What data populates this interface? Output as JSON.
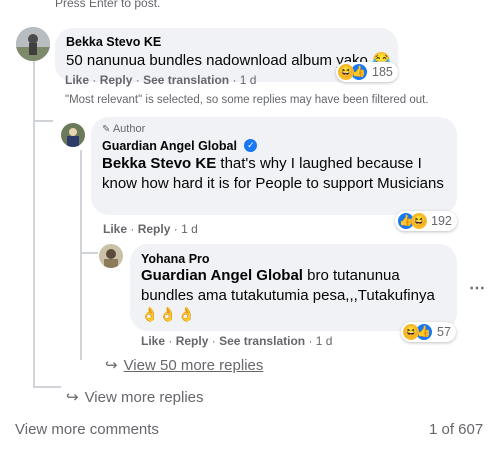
{
  "composer": {
    "hint": "Press Enter to post."
  },
  "comment1": {
    "author": "Bekka Stevo KE",
    "text": "50 nanunua bundles nadownload album yako",
    "emoji": "😂",
    "reaction_count": "185",
    "actions": {
      "like": "Like",
      "reply": "Reply",
      "translate": "See translation",
      "time": "1 d"
    }
  },
  "filter_note": "\"Most relevant\" is selected, so some replies may have been filtered out.",
  "reply1": {
    "badge": "Author",
    "author": "Guardian Angel Global",
    "mention": "Bekka Stevo KE",
    "text": " that's why I laughed because I know how hard it is for People to support Musicians",
    "reaction_count": "192",
    "actions": {
      "like": "Like",
      "reply": "Reply",
      "time": "1 d"
    }
  },
  "reply2": {
    "author": "Yohana Pro",
    "mention": "Guardian Angel Global",
    "text": " bro tutanunua bundles ama tutakutumia pesa,,,Tutakufinya",
    "emojis": "👌👌👌",
    "reaction_count": "57",
    "actions": {
      "like": "Like",
      "reply": "Reply",
      "translate": "See translation",
      "time": "1 d"
    }
  },
  "view_more_replies_nested": "View 50 more replies",
  "view_more_replies": "View more replies",
  "view_more_comments": "View more comments",
  "pagination": "1 of 607",
  "separator": "·",
  "colors": {
    "accent": "#1877f2",
    "bubble": "#f0f2f5",
    "muted": "#65676b"
  }
}
